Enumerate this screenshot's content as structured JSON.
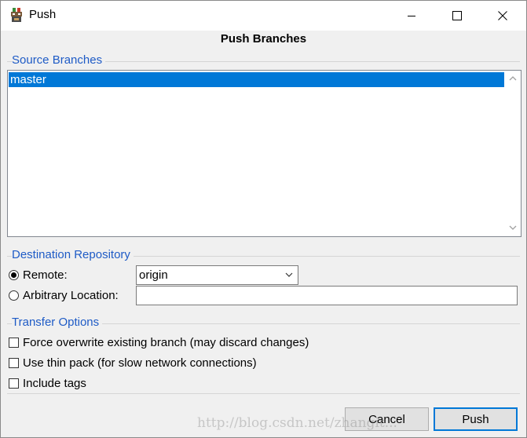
{
  "window": {
    "title": "Push"
  },
  "dialog": {
    "heading": "Push Branches"
  },
  "source": {
    "group_label": "Source Branches",
    "branches": [
      "master"
    ],
    "selected": "master"
  },
  "destination": {
    "group_label": "Destination Repository",
    "remote_label": "Remote:",
    "remote_value": "origin",
    "remote_selected": true,
    "arbitrary_label": "Arbitrary Location:",
    "arbitrary_value": ""
  },
  "transfer": {
    "group_label": "Transfer Options",
    "force_label": "Force overwrite existing branch (may discard changes)",
    "thin_pack_label": "Use thin pack (for slow network connections)",
    "tags_label": "Include tags"
  },
  "buttons": {
    "cancel": "Cancel",
    "push": "Push"
  },
  "watermark": "http://blog.csdn.net/zhangit..."
}
